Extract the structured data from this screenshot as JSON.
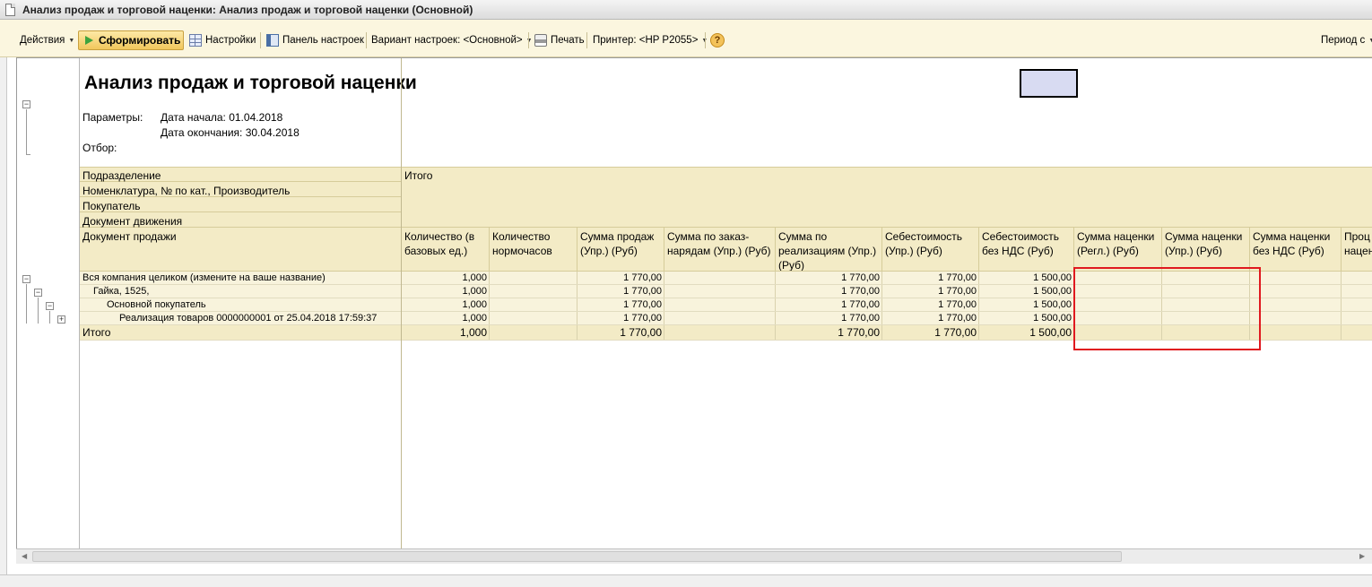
{
  "window": {
    "title": "Анализ продаж и торговой наценки: Анализ продаж и торговой наценки (Основной)"
  },
  "toolbar": {
    "actions": "Действия",
    "generate": "Сформировать",
    "settings": "Настройки",
    "settings_panel": "Панель настроек",
    "variant": "Вариант настроек: <Основной>",
    "print": "Печать",
    "printer": "Принтер: <HP P2055>",
    "period": "Период с",
    "help": "?"
  },
  "report": {
    "title": "Анализ продаж и торговой наценки",
    "params_label": "Параметры:",
    "date_start": "Дата начала: 01.04.2018",
    "date_end": "Дата окончания: 30.04.2018",
    "filter_label": "Отбор:",
    "header_groups": [
      "Подразделение",
      "Номенклатура, № по кат., Производитель",
      "Покупатель",
      "Документ движения",
      "Документ продажи"
    ],
    "header_total": "Итого",
    "columns": [
      "Количество (в базовых ед.)",
      "Количество нормочасов",
      "Сумма продаж (Упр.) (Руб)",
      "Сумма по заказ-нарядам (Упр.) (Руб)",
      "Сумма по реализациям (Упр.) (Руб)",
      "Себестоимость (Упр.) (Руб)",
      "Себестоимость без НДС (Руб)",
      "Сумма наценки (Регл.) (Руб)",
      "Сумма наценки (Упр.) (Руб)",
      "Сумма наценки без НДС (Руб)",
      "Проц нацен"
    ],
    "rows": [
      {
        "label": "Вся компания целиком (измените на ваше название)",
        "values": [
          "1,000",
          "",
          "1 770,00",
          "",
          "1 770,00",
          "1 770,00",
          "1 500,00",
          "",
          "",
          "",
          ""
        ]
      },
      {
        "label": "Гайка, 1525,",
        "values": [
          "1,000",
          "",
          "1 770,00",
          "",
          "1 770,00",
          "1 770,00",
          "1 500,00",
          "",
          "",
          "",
          ""
        ]
      },
      {
        "label": "Основной покупатель",
        "values": [
          "1,000",
          "",
          "1 770,00",
          "",
          "1 770,00",
          "1 770,00",
          "1 500,00",
          "",
          "",
          "",
          ""
        ]
      },
      {
        "label": "Реализация товаров 0000000001 от 25.04.2018 17:59:37",
        "values": [
          "1,000",
          "",
          "1 770,00",
          "",
          "1 770,00",
          "1 770,00",
          "1 500,00",
          "",
          "",
          "",
          ""
        ]
      }
    ],
    "total": {
      "label": "Итого",
      "values": [
        "1,000",
        "",
        "1 770,00",
        "",
        "1 770,00",
        "1 770,00",
        "1 500,00",
        "",
        "",
        "",
        ""
      ]
    }
  }
}
